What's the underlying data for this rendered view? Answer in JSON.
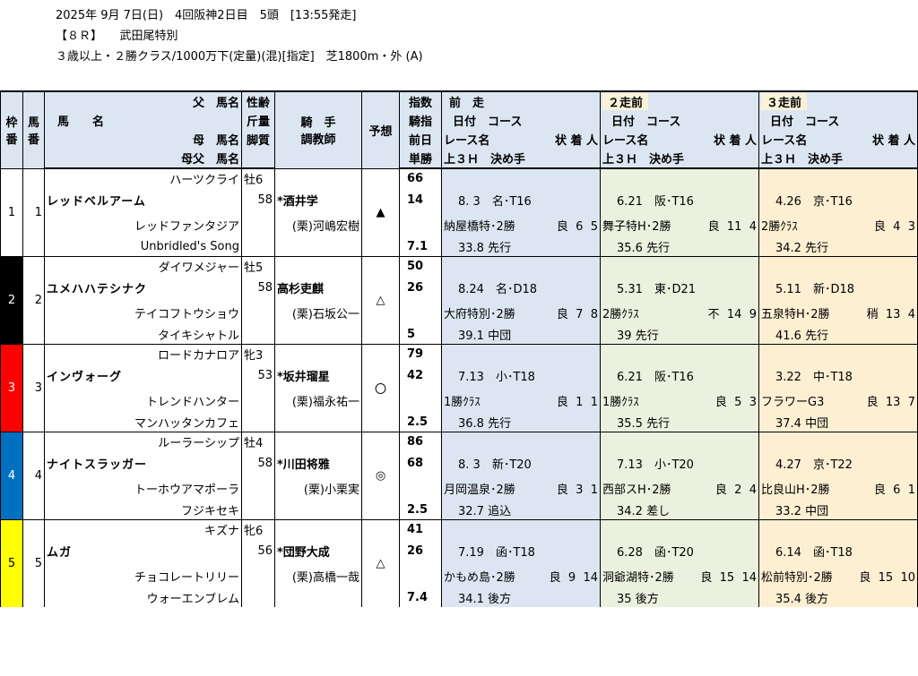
{
  "header": {
    "line1": "2025年 9月 7日(日)　4回阪神2日目　5頭　[13:55発走]",
    "line2": "【８Ｒ】　　武田尾特別",
    "line3": "３歳以上・２勝クラス/1000万下(定量)(混)[指定]　芝1800m・外 (A)"
  },
  "columns": {
    "waku": [
      "枠",
      "番"
    ],
    "uma": [
      "馬",
      "番"
    ],
    "father": "父　馬名",
    "name": "馬　　名",
    "mother": "母　馬名",
    "mothers_father": "母父　馬名",
    "sex_age": "性齢",
    "weight": "斤量",
    "style": "脚質",
    "jockey": "騎　手",
    "trainer": "調教師",
    "prediction": "予想",
    "index": "指数",
    "jockey_index": "騎指",
    "prev_day": "前日",
    "odds": "単勝",
    "prev1_title": "前　走",
    "prev2_title": "２走前",
    "prev3_title": "３走前",
    "date_course": "日付　コース",
    "race_line": "レース名",
    "race_tail": "状 着 人",
    "last3f": "上３Ｈ　決め手"
  },
  "horses": [
    {
      "waku": "1",
      "waku_color": "#ffffff",
      "waku_text": "#000000",
      "num": "1",
      "father": "ハーツクライ",
      "name": "レッドベルアーム",
      "mother": "レッドファンタジア",
      "mothers_father": "Unbridled's Song",
      "sex_age": "牡6",
      "weight": "58",
      "jockey": "*酒井学",
      "trainer": "(栗)河嶋宏樹",
      "mark": "▲",
      "index": "66",
      "jockey_index": "14",
      "odds": "7.1",
      "p1": {
        "date": "8. 3",
        "course": "名･T16",
        "race": "納屋橋特･2勝",
        "cond": "良",
        "finish": "6",
        "pop": "5",
        "last3f": "33.8",
        "style": "先行"
      },
      "p2": {
        "date": "6.21",
        "course": "阪･T16",
        "race": "舞子特H･2勝",
        "cond": "良",
        "finish": "11",
        "pop": "4",
        "last3f": "35.6",
        "style": "先行"
      },
      "p3": {
        "date": "4.26",
        "course": "京･T16",
        "race": "2勝ｸﾗｽ",
        "cond": "良",
        "finish": "4",
        "pop": "3",
        "last3f": "34.2",
        "style": "先行"
      }
    },
    {
      "waku": "2",
      "waku_color": "#000000",
      "waku_text": "#ffffff",
      "num": "2",
      "father": "ダイワメジャー",
      "name": "ユメハハテシナク",
      "mother": "テイコフトウショウ",
      "mothers_father": "タイキシャトル",
      "sex_age": "牡5",
      "weight": "58",
      "jockey": "高杉吏麒",
      "trainer": "(栗)石坂公一",
      "mark": "△",
      "index": "50",
      "jockey_index": "26",
      "odds": "5",
      "p1": {
        "date": "8.24",
        "course": "名･D18",
        "race": "大府特別･2勝",
        "cond": "良",
        "finish": "7",
        "pop": "8",
        "last3f": "39.1",
        "style": "中団"
      },
      "p2": {
        "date": "5.31",
        "course": "東･D21",
        "race": "2勝ｸﾗｽ",
        "cond": "不",
        "finish": "14",
        "pop": "9",
        "last3f": "39",
        "style": "先行"
      },
      "p3": {
        "date": "5.11",
        "course": "新･D18",
        "race": "五泉特H･2勝",
        "cond": "稍",
        "finish": "13",
        "pop": "4",
        "last3f": "41.6",
        "style": "先行"
      }
    },
    {
      "waku": "3",
      "waku_color": "#ff0000",
      "waku_text": "#ffffff",
      "num": "3",
      "father": "ロードカナロア",
      "name": "インヴォーグ",
      "mother": "トレンドハンター",
      "mothers_father": "マンハッタンカフェ",
      "sex_age": "牝3",
      "weight": "53",
      "jockey": "*坂井瑠星",
      "trainer": "(栗)福永祐一",
      "mark": "〇",
      "index": "79",
      "jockey_index": "42",
      "odds": "2.5",
      "p1": {
        "date": "7.13",
        "course": "小･T18",
        "race": "1勝ｸﾗｽ",
        "cond": "良",
        "finish": "1",
        "pop": "1",
        "last3f": "36.8",
        "style": "先行"
      },
      "p2": {
        "date": "6.21",
        "course": "阪･T16",
        "race": "1勝ｸﾗｽ",
        "cond": "良",
        "finish": "5",
        "pop": "3",
        "last3f": "35.5",
        "style": "先行"
      },
      "p3": {
        "date": "3.22",
        "course": "中･T18",
        "race": "フラワーG3",
        "cond": "良",
        "finish": "13",
        "pop": "7",
        "last3f": "37.4",
        "style": "中団"
      }
    },
    {
      "waku": "4",
      "waku_color": "#0070c0",
      "waku_text": "#ffffff",
      "num": "4",
      "father": "ルーラーシップ",
      "name": "ナイトスラッガー",
      "mother": "トーホウアマポーラ",
      "mothers_father": "フジキセキ",
      "sex_age": "牡4",
      "weight": "58",
      "jockey": "*川田将雅",
      "trainer": "(栗)小栗実",
      "mark": "◎",
      "index": "86",
      "jockey_index": "68",
      "odds": "2.5",
      "p1": {
        "date": "8. 3",
        "course": "新･T20",
        "race": "月岡温泉･2勝",
        "cond": "良",
        "finish": "3",
        "pop": "1",
        "last3f": "32.7",
        "style": "追込"
      },
      "p2": {
        "date": "7.13",
        "course": "小･T20",
        "race": "西部スH･2勝",
        "cond": "良",
        "finish": "2",
        "pop": "4",
        "last3f": "34.2",
        "style": "差し"
      },
      "p3": {
        "date": "4.27",
        "course": "京･T22",
        "race": "比良山H･2勝",
        "cond": "良",
        "finish": "6",
        "pop": "1",
        "last3f": "33.2",
        "style": "中団"
      }
    },
    {
      "waku": "5",
      "waku_color": "#ffff00",
      "waku_text": "#000000",
      "num": "5",
      "father": "キズナ",
      "name": "ムガ",
      "mother": "チョコレートリリー",
      "mothers_father": "ウォーエンブレム",
      "sex_age": "牝6",
      "weight": "56",
      "jockey": "*団野大成",
      "trainer": "(栗)高橋一哉",
      "mark": "△",
      "index": "41",
      "jockey_index": "26",
      "odds": "7.4",
      "p1": {
        "date": "7.19",
        "course": "函･T18",
        "race": "かもめ島･2勝",
        "cond": "良",
        "finish": "9",
        "pop": "14",
        "last3f": "34.1",
        "style": "後方"
      },
      "p2": {
        "date": "6.28",
        "course": "函･T20",
        "race": "洞爺湖特･2勝",
        "cond": "良",
        "finish": "15",
        "pop": "14",
        "last3f": "35",
        "style": "後方"
      },
      "p3": {
        "date": "6.14",
        "course": "函･T18",
        "race": "松前特別･2勝",
        "cond": "良",
        "finish": "15",
        "pop": "10",
        "last3f": "35.4",
        "style": "後方"
      }
    }
  ]
}
